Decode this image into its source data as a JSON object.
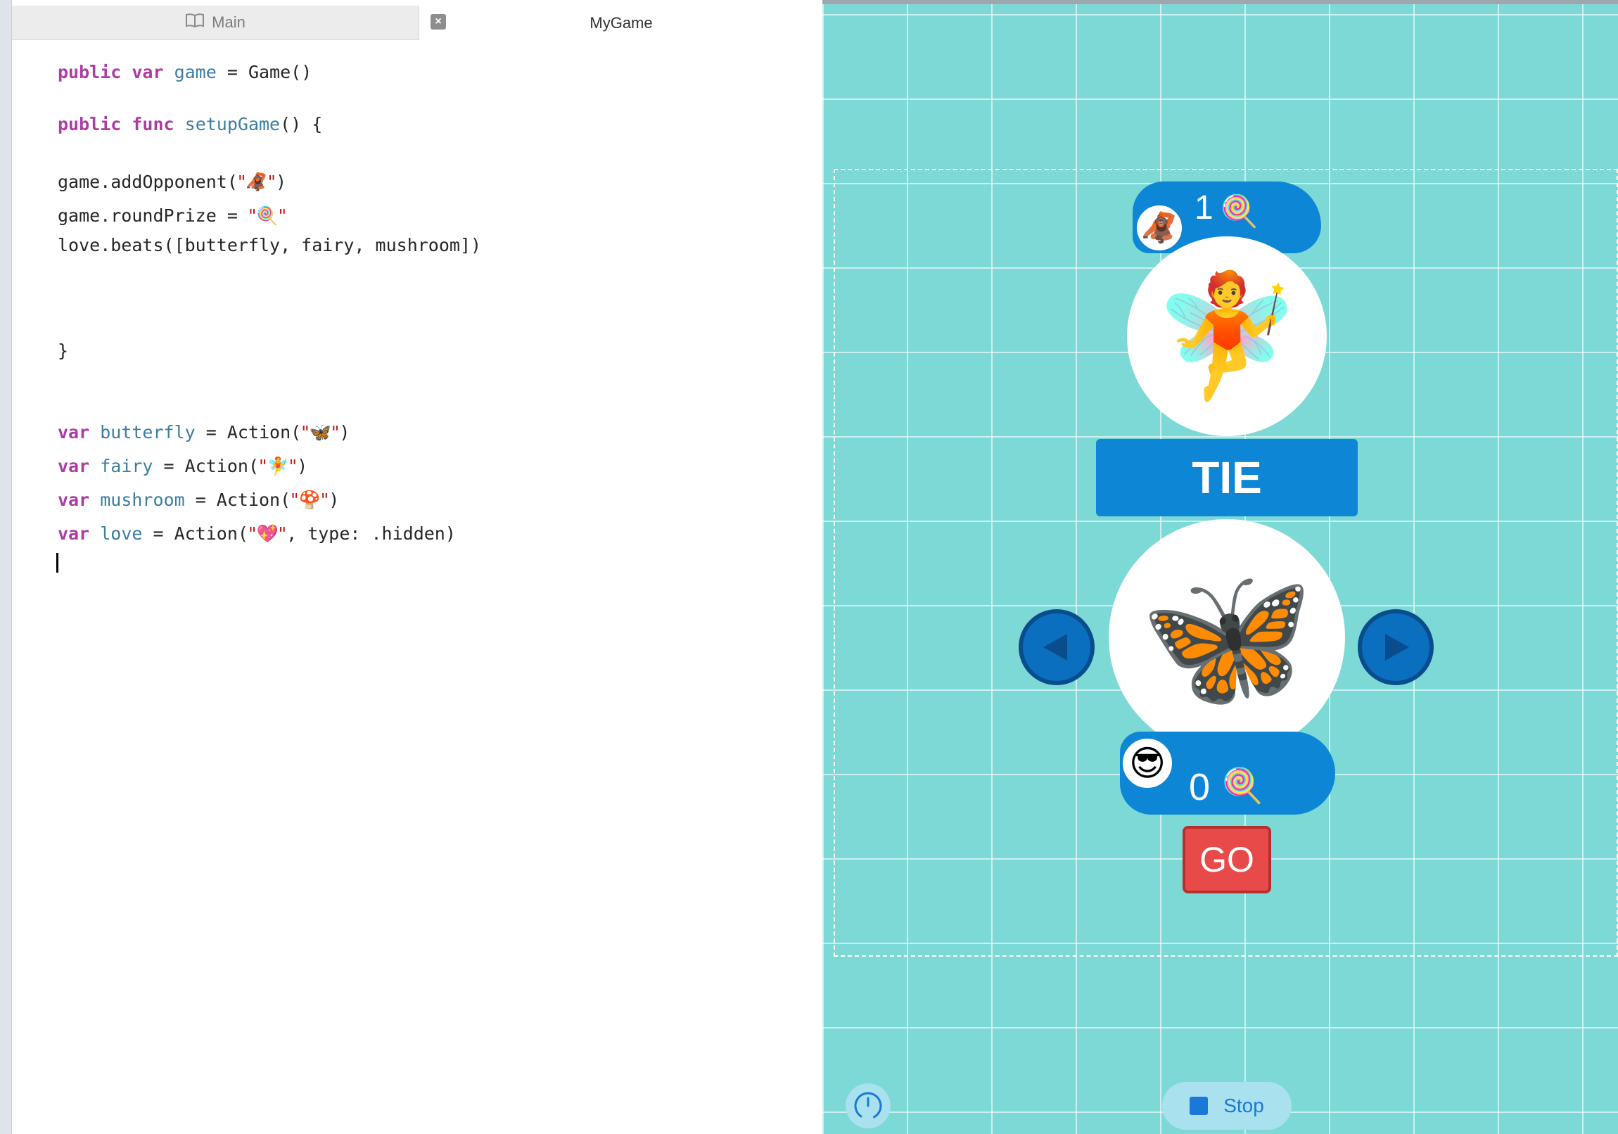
{
  "tabs": {
    "main_label": "Main",
    "mygame_label": "MyGame"
  },
  "code": {
    "l1": {
      "k1": "public var",
      "id": "game",
      "rest": " = Game()"
    },
    "l2": {
      "k1": "public func",
      "id": "setupGame",
      "rest": "() {"
    },
    "l3": {
      "pre": "game.addOpponent(",
      "s": "\"🦧\"",
      "post": ")"
    },
    "l4": {
      "pre": "game.roundPrize = ",
      "s": "\"🍭\""
    },
    "l5": "love.beats([butterfly, fairy, mushroom])",
    "l6": "}",
    "l7": {
      "k": "var",
      "id": "butterfly",
      "pre": " = Action(",
      "s": "\"🦋\"",
      "post": ")"
    },
    "l8": {
      "k": "var",
      "id": "fairy",
      "pre": " = Action(",
      "s": "\"🧚\"",
      "post": ")"
    },
    "l9": {
      "k": "var",
      "id": "mushroom",
      "pre": " = Action(",
      "s": "\"🍄\"",
      "post": ")"
    },
    "l10": {
      "k": "var",
      "id": "love",
      "pre": " = Action(",
      "s": "\"💖\"",
      "post": ", type: .hidden)"
    }
  },
  "game": {
    "opponent_avatar": "🦧",
    "opponent_score": "1",
    "prize": "🍭",
    "opponent_choice": "🧚",
    "result": "TIE",
    "player_choice": "🦋",
    "player_avatar": "😎",
    "player_score": "0",
    "go_label": "GO",
    "stop_label": "Stop"
  },
  "icons": {
    "book": "book-icon",
    "close": "close-icon",
    "left": "left-arrow-icon",
    "right": "right-arrow-icon",
    "meter": "speed-meter-icon",
    "stop": "stop-icon"
  },
  "colors": {
    "background": "#7dd9d6",
    "accent": "#0d86d6",
    "go": "#e84a4a",
    "keyword": "#ad3da4",
    "identifier": "#3b7ea1",
    "string": "#c41a16"
  }
}
